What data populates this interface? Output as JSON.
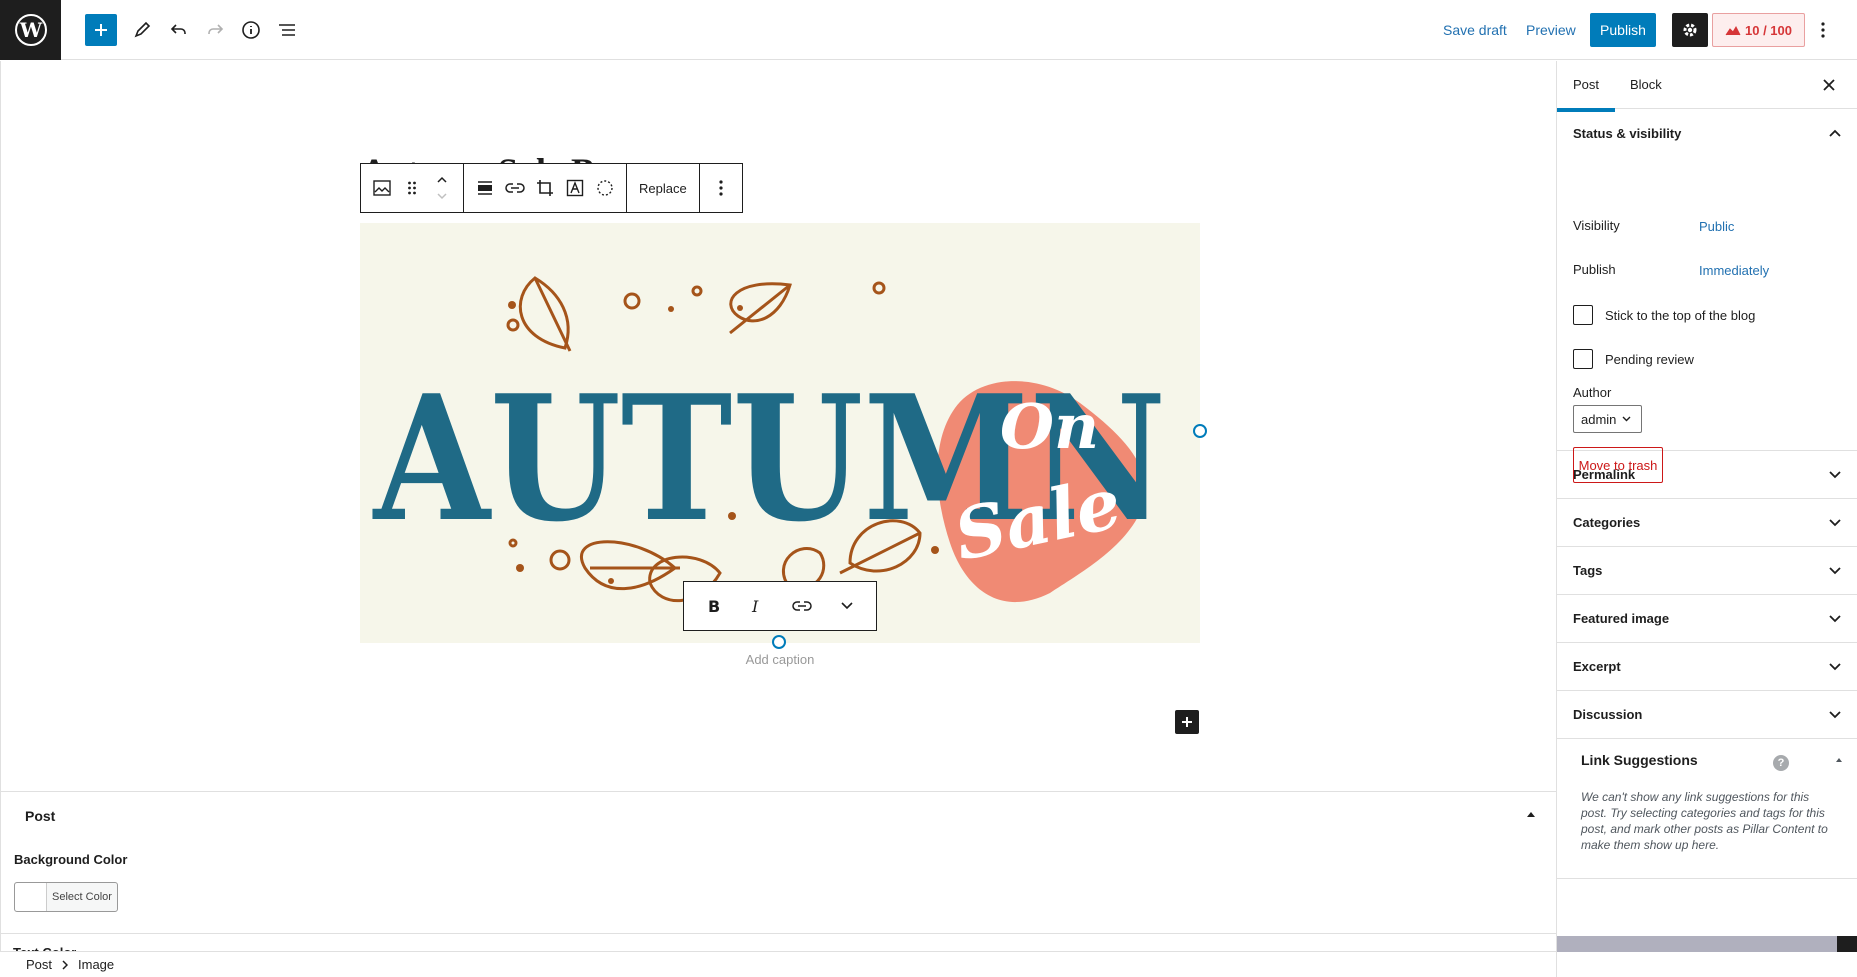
{
  "topbar": {
    "save_draft": "Save draft",
    "preview": "Preview",
    "publish": "Publish",
    "score": "10 / 100"
  },
  "editor": {
    "post_title": "Autumn Sale Banner",
    "block_toolbar": {
      "replace": "Replace"
    },
    "image": {
      "text_main": "AUTUMN",
      "text_on": "On",
      "text_sale": "Sale",
      "colors": {
        "background": "#f6f6ea",
        "title": "#1f6a86",
        "blob": "#f08a74",
        "leaf": "#a5541a"
      }
    },
    "caption_placeholder": "Add caption"
  },
  "metabox": {
    "title": "Post",
    "background_color_label": "Background Color",
    "select_color": "Select Color",
    "cutoff_label": "Text Color"
  },
  "breadcrumb": {
    "items": [
      "Post",
      "Image"
    ]
  },
  "sidebar": {
    "tabs": [
      "Post",
      "Block"
    ],
    "status": {
      "title": "Status & visibility",
      "visibility_label": "Visibility",
      "visibility_value": "Public",
      "publish_label": "Publish",
      "publish_value": "Immediately",
      "sticky_label": "Stick to the top of the blog",
      "pending_label": "Pending review",
      "author_label": "Author",
      "author_value": "admin",
      "trash": "Move to trash"
    },
    "panels": [
      "Permalink",
      "Categories",
      "Tags",
      "Featured image",
      "Excerpt",
      "Discussion"
    ],
    "link_suggestions": {
      "title": "Link Suggestions",
      "help": "?",
      "body": "We can't show any link suggestions for this post. Try selecting categories and tags for this post, and mark other posts as Pillar Content to make them show up here."
    }
  },
  "accent_color": "#007cba"
}
